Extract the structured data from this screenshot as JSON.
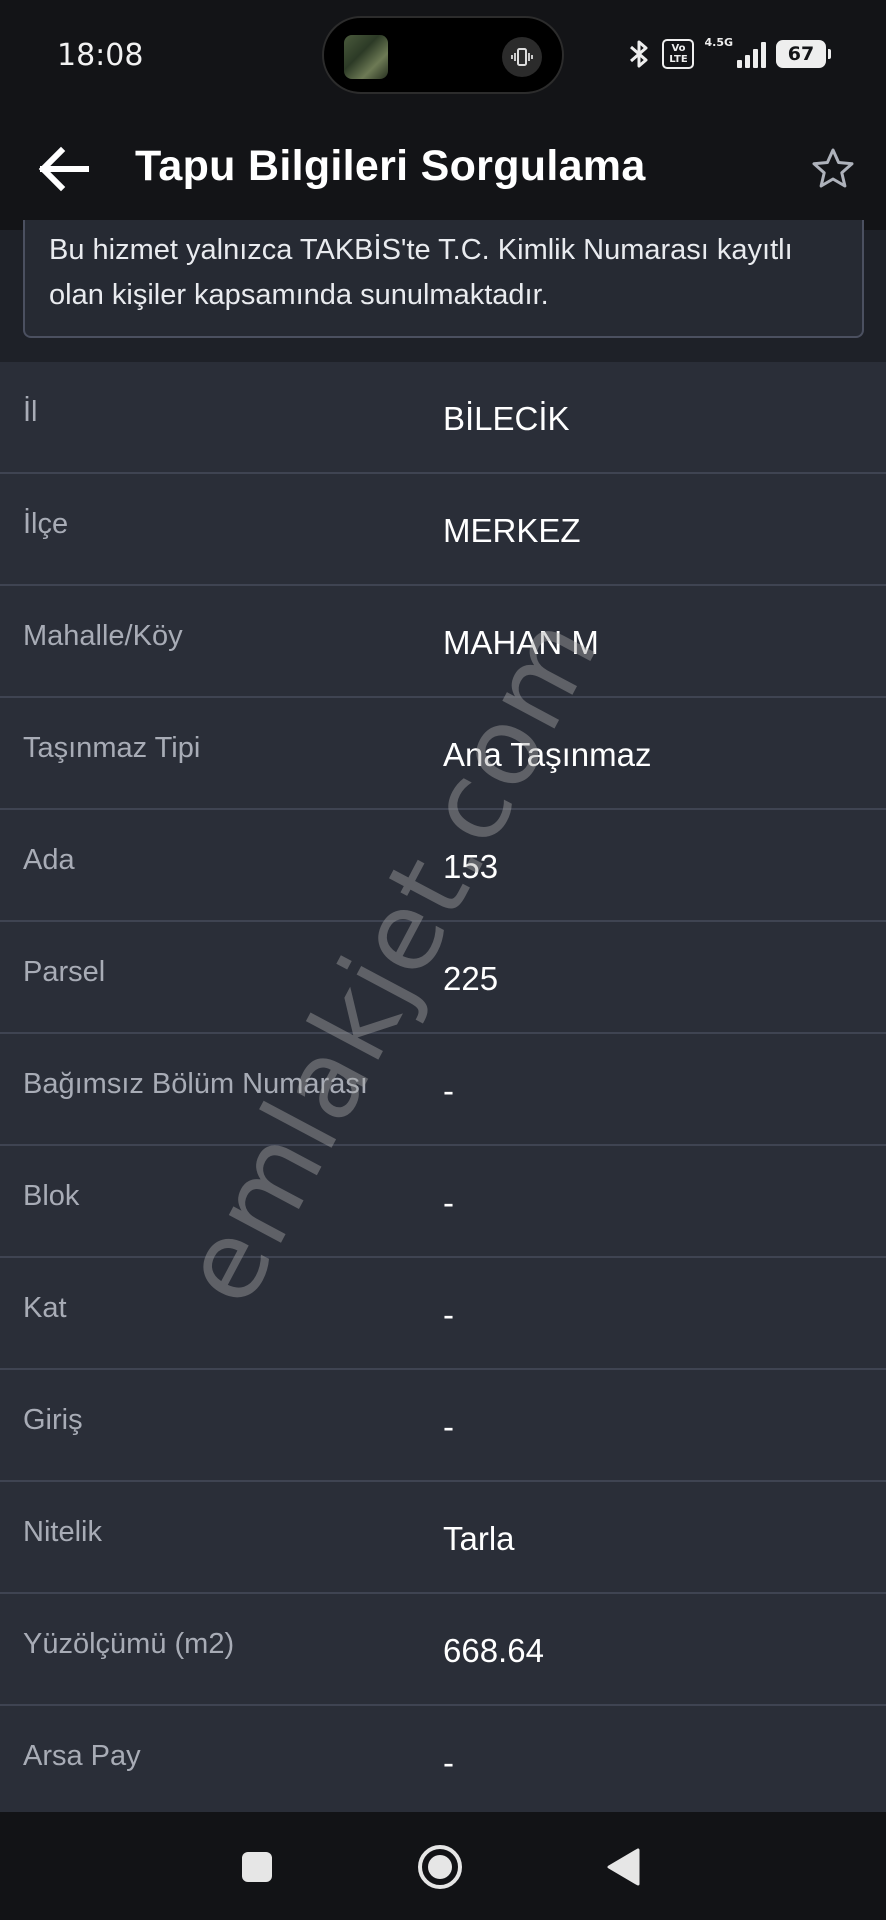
{
  "status_bar": {
    "time": "18:08",
    "volte": "Vo LTE",
    "network": "4.5G",
    "battery": "67",
    "icons": [
      "bluetooth-icon",
      "volte-icon",
      "signal-icon",
      "battery-icon"
    ]
  },
  "app_bar": {
    "title": "Tapu Bilgileri Sorgulama",
    "back_icon": "arrow-left-icon",
    "favorite_icon": "star-outline-icon"
  },
  "notice": {
    "text": "Bu hizmet yalnızca TAKBİS'te T.C. Kimlik Numarası kayıtlı olan kişiler kapsamında sunulmaktadır."
  },
  "rows": [
    {
      "label": "İl",
      "value": "BİLECİK"
    },
    {
      "label": "İlçe",
      "value": "MERKEZ"
    },
    {
      "label": "Mahalle/Köy",
      "value": "MAHAN M"
    },
    {
      "label": "Taşınmaz Tipi",
      "value": "Ana Taşınmaz"
    },
    {
      "label": "Ada",
      "value": "153"
    },
    {
      "label": "Parsel",
      "value": "225"
    },
    {
      "label": "Bağımsız Bölüm Numarası",
      "value": "-"
    },
    {
      "label": "Blok",
      "value": "-"
    },
    {
      "label": "Kat",
      "value": "-"
    },
    {
      "label": "Giriş",
      "value": "-"
    },
    {
      "label": "Nitelik",
      "value": "Tarla"
    },
    {
      "label": "Yüzölçümü (m2)",
      "value": "668.64"
    },
    {
      "label": "Arsa Pay",
      "value": "-"
    }
  ],
  "watermark": "emlakjet.com",
  "nav_bar": {
    "icons": [
      "recents-square-icon",
      "home-circle-icon",
      "back-triangle-icon"
    ]
  },
  "colors": {
    "background": "#2a2e38",
    "app_bar": "#131417",
    "label": "#a8acb6",
    "value": "#ffffff",
    "divider": "#3f4452"
  }
}
